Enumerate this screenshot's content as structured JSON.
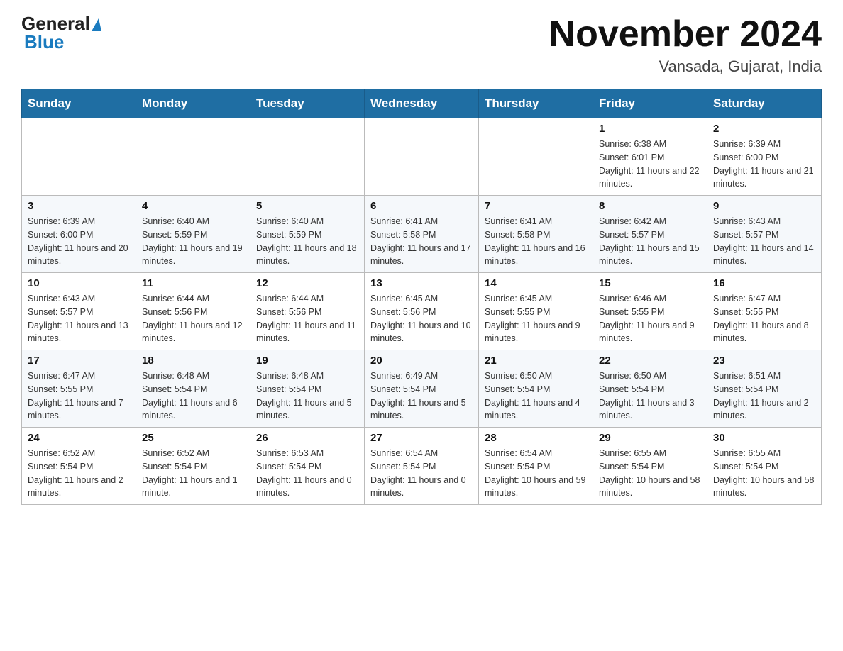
{
  "header": {
    "logo_general": "General",
    "logo_blue": "Blue",
    "title": "November 2024",
    "subtitle": "Vansada, Gujarat, India"
  },
  "weekdays": [
    "Sunday",
    "Monday",
    "Tuesday",
    "Wednesday",
    "Thursday",
    "Friday",
    "Saturday"
  ],
  "weeks": [
    [
      {
        "day": "",
        "info": ""
      },
      {
        "day": "",
        "info": ""
      },
      {
        "day": "",
        "info": ""
      },
      {
        "day": "",
        "info": ""
      },
      {
        "day": "",
        "info": ""
      },
      {
        "day": "1",
        "info": "Sunrise: 6:38 AM\nSunset: 6:01 PM\nDaylight: 11 hours and 22 minutes."
      },
      {
        "day": "2",
        "info": "Sunrise: 6:39 AM\nSunset: 6:00 PM\nDaylight: 11 hours and 21 minutes."
      }
    ],
    [
      {
        "day": "3",
        "info": "Sunrise: 6:39 AM\nSunset: 6:00 PM\nDaylight: 11 hours and 20 minutes."
      },
      {
        "day": "4",
        "info": "Sunrise: 6:40 AM\nSunset: 5:59 PM\nDaylight: 11 hours and 19 minutes."
      },
      {
        "day": "5",
        "info": "Sunrise: 6:40 AM\nSunset: 5:59 PM\nDaylight: 11 hours and 18 minutes."
      },
      {
        "day": "6",
        "info": "Sunrise: 6:41 AM\nSunset: 5:58 PM\nDaylight: 11 hours and 17 minutes."
      },
      {
        "day": "7",
        "info": "Sunrise: 6:41 AM\nSunset: 5:58 PM\nDaylight: 11 hours and 16 minutes."
      },
      {
        "day": "8",
        "info": "Sunrise: 6:42 AM\nSunset: 5:57 PM\nDaylight: 11 hours and 15 minutes."
      },
      {
        "day": "9",
        "info": "Sunrise: 6:43 AM\nSunset: 5:57 PM\nDaylight: 11 hours and 14 minutes."
      }
    ],
    [
      {
        "day": "10",
        "info": "Sunrise: 6:43 AM\nSunset: 5:57 PM\nDaylight: 11 hours and 13 minutes."
      },
      {
        "day": "11",
        "info": "Sunrise: 6:44 AM\nSunset: 5:56 PM\nDaylight: 11 hours and 12 minutes."
      },
      {
        "day": "12",
        "info": "Sunrise: 6:44 AM\nSunset: 5:56 PM\nDaylight: 11 hours and 11 minutes."
      },
      {
        "day": "13",
        "info": "Sunrise: 6:45 AM\nSunset: 5:56 PM\nDaylight: 11 hours and 10 minutes."
      },
      {
        "day": "14",
        "info": "Sunrise: 6:45 AM\nSunset: 5:55 PM\nDaylight: 11 hours and 9 minutes."
      },
      {
        "day": "15",
        "info": "Sunrise: 6:46 AM\nSunset: 5:55 PM\nDaylight: 11 hours and 9 minutes."
      },
      {
        "day": "16",
        "info": "Sunrise: 6:47 AM\nSunset: 5:55 PM\nDaylight: 11 hours and 8 minutes."
      }
    ],
    [
      {
        "day": "17",
        "info": "Sunrise: 6:47 AM\nSunset: 5:55 PM\nDaylight: 11 hours and 7 minutes."
      },
      {
        "day": "18",
        "info": "Sunrise: 6:48 AM\nSunset: 5:54 PM\nDaylight: 11 hours and 6 minutes."
      },
      {
        "day": "19",
        "info": "Sunrise: 6:48 AM\nSunset: 5:54 PM\nDaylight: 11 hours and 5 minutes."
      },
      {
        "day": "20",
        "info": "Sunrise: 6:49 AM\nSunset: 5:54 PM\nDaylight: 11 hours and 5 minutes."
      },
      {
        "day": "21",
        "info": "Sunrise: 6:50 AM\nSunset: 5:54 PM\nDaylight: 11 hours and 4 minutes."
      },
      {
        "day": "22",
        "info": "Sunrise: 6:50 AM\nSunset: 5:54 PM\nDaylight: 11 hours and 3 minutes."
      },
      {
        "day": "23",
        "info": "Sunrise: 6:51 AM\nSunset: 5:54 PM\nDaylight: 11 hours and 2 minutes."
      }
    ],
    [
      {
        "day": "24",
        "info": "Sunrise: 6:52 AM\nSunset: 5:54 PM\nDaylight: 11 hours and 2 minutes."
      },
      {
        "day": "25",
        "info": "Sunrise: 6:52 AM\nSunset: 5:54 PM\nDaylight: 11 hours and 1 minute."
      },
      {
        "day": "26",
        "info": "Sunrise: 6:53 AM\nSunset: 5:54 PM\nDaylight: 11 hours and 0 minutes."
      },
      {
        "day": "27",
        "info": "Sunrise: 6:54 AM\nSunset: 5:54 PM\nDaylight: 11 hours and 0 minutes."
      },
      {
        "day": "28",
        "info": "Sunrise: 6:54 AM\nSunset: 5:54 PM\nDaylight: 10 hours and 59 minutes."
      },
      {
        "day": "29",
        "info": "Sunrise: 6:55 AM\nSunset: 5:54 PM\nDaylight: 10 hours and 58 minutes."
      },
      {
        "day": "30",
        "info": "Sunrise: 6:55 AM\nSunset: 5:54 PM\nDaylight: 10 hours and 58 minutes."
      }
    ]
  ]
}
